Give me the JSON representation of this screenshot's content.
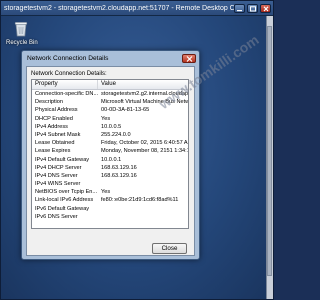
{
  "window": {
    "title": "storagetestvm2 - storagetestvm2.cloudapp.net:51707 - Remote Desktop Connection",
    "title_display": "storagetestvm2 - storagetestvm2.cloudapp.net:51707 - Remote Desktop Connectio"
  },
  "desktop": {
    "recycle_bin_label": "Recycle Bin"
  },
  "dialog": {
    "title": "Network Connection Details",
    "caption": "Network Connection Details:",
    "columns": {
      "property": "Property",
      "value": "Value"
    },
    "rows": [
      {
        "property": "Connection-specific DN...",
        "value": "storagetestvm2.g2.internal.cloudapp.net"
      },
      {
        "property": "Description",
        "value": "Microsoft Virtual Machine Bus Network A"
      },
      {
        "property": "Physical Address",
        "value": "00-0D-3A-81-13-65"
      },
      {
        "property": "DHCP Enabled",
        "value": "Yes"
      },
      {
        "property": "IPv4 Address",
        "value": "10.0.0.5"
      },
      {
        "property": "IPv4 Subnet Mask",
        "value": "255.224.0.0"
      },
      {
        "property": "Lease Obtained",
        "value": "Friday, October 02, 2015 6:40:57 AM"
      },
      {
        "property": "Lease Expires",
        "value": "Monday, November 08, 2151 1:34:14 PM"
      },
      {
        "property": "IPv4 Default Gateway",
        "value": "10.0.0.1"
      },
      {
        "property": "IPv4 DHCP Server",
        "value": "168.63.129.16"
      },
      {
        "property": "IPv4 DNS Server",
        "value": "168.63.129.16"
      },
      {
        "property": "IPv4 WINS Server",
        "value": ""
      },
      {
        "property": "NetBIOS over Tcpip En...",
        "value": "Yes"
      },
      {
        "property": "Link-local IPv6 Address",
        "value": "fe80::e0be:21d9:1cd6:f8ad%11"
      },
      {
        "property": "IPv6 Default Gateway",
        "value": ""
      },
      {
        "property": "IPv6 DNS Server",
        "value": ""
      }
    ],
    "close_label": "Close"
  },
  "watermark": {
    "text": "www.tomkilli.com"
  },
  "colors": {
    "desktop_background": "#24477a",
    "dialog_frame": "#a9bfd9",
    "close_button_red": "#b53320"
  },
  "icons": {
    "recycle_bin": "recycle-bin-icon",
    "minimize": "minimize-icon",
    "maximize": "maximize-icon",
    "close": "close-icon"
  }
}
